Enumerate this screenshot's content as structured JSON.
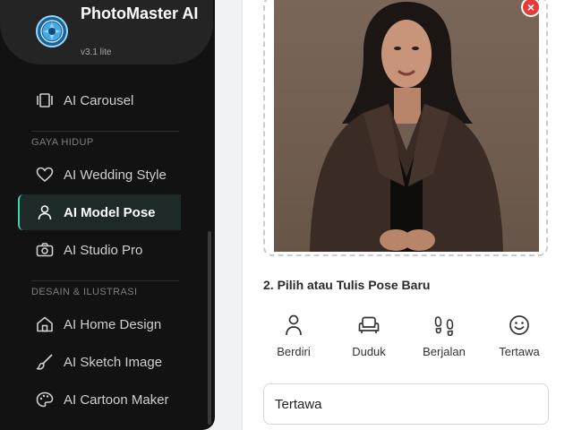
{
  "app": {
    "title": "PhotoMaster AI",
    "version": "v3.1 lite"
  },
  "sidebar": {
    "sections": [
      {
        "label": "GAYA HIDUP"
      },
      {
        "label": "DESAIN & ILUSTRASI"
      }
    ],
    "items": [
      {
        "label": "AI Carousel",
        "icon": "carousel-icon"
      },
      {
        "label": "AI Wedding Style",
        "icon": "heart-icon"
      },
      {
        "label": "AI Model Pose",
        "icon": "person-icon",
        "active": true
      },
      {
        "label": "AI Studio Pro",
        "icon": "camera-icon"
      },
      {
        "label": "AI Home Design",
        "icon": "home-icon"
      },
      {
        "label": "AI Sketch Image",
        "icon": "brush-icon"
      },
      {
        "label": "AI Cartoon Maker",
        "icon": "palette-icon"
      }
    ]
  },
  "main": {
    "step_title": "2. Pilih atau Tulis Pose Baru",
    "close_symbol": "×",
    "poses": [
      {
        "label": "Berdiri",
        "icon": "standing-person-icon"
      },
      {
        "label": "Duduk",
        "icon": "sofa-icon"
      },
      {
        "label": "Berjalan",
        "icon": "footprints-icon"
      },
      {
        "label": "Tertawa",
        "icon": "smile-icon"
      }
    ],
    "pose_input": {
      "value": "Tertawa"
    }
  },
  "colors": {
    "sidebar_bg": "#121212",
    "accent": "#35d6b0",
    "danger": "#e83a3a"
  }
}
